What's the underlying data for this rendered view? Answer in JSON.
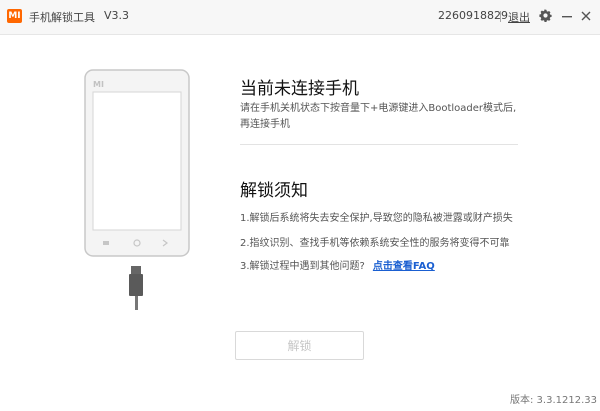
{
  "titlebar": {
    "logo_text": "MI",
    "app_name": "手机解锁工具",
    "version": "V3.3",
    "account_id": "2260918829",
    "logout": "退出"
  },
  "icons": {
    "settings": "gear-icon",
    "minimize": "minimize-icon",
    "close": "close-icon",
    "phone": "phone-illustration-icon"
  },
  "phone": {
    "brand_text": "MI"
  },
  "main": {
    "connect_title": "当前未连接手机",
    "connect_instruction": "请在手机关机状态下按音量下+电源键进入Bootloader模式后,再连接手机",
    "unlock_title": "解锁须知",
    "notices": [
      "1.解锁后系统将失去安全保护,导致您的隐私被泄露或财产损失",
      "2.指纹识别、查找手机等依赖系统安全性的服务将变得不可靠",
      "3.解锁过程中遇到其他问题?"
    ],
    "faq_link": "点击查看FAQ",
    "unlock_button": "解锁"
  },
  "footer": {
    "version_text": "版本: 3.3.1212.33"
  },
  "colors": {
    "accent_logo": "#ff6700",
    "link": "#1a5fd1",
    "button_text_disabled": "#c6c6c6"
  }
}
